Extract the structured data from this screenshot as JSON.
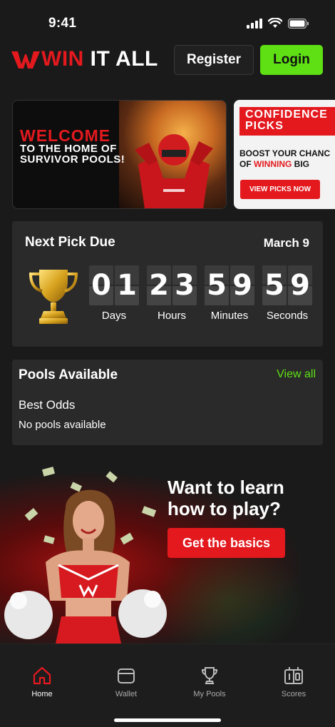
{
  "status": {
    "time": "9:41"
  },
  "header": {
    "logo_red": "WIN",
    "logo_white": "IT ALL",
    "register_label": "Register",
    "login_label": "Login"
  },
  "banners": {
    "welcome_title": "WELCOME",
    "welcome_sub": "TO THE HOME OF SURVIVOR POOLS!",
    "picks_title": "CONFIDENCE PICKS",
    "picks_line1": "BOOST YOUR CHANC",
    "picks_line2_prefix": "OF ",
    "picks_line2_red": "WINNING",
    "picks_line2_suffix": " BIG",
    "picks_button": "VIEW PICKS NOW"
  },
  "countdown": {
    "title": "Next Pick Due",
    "date": "March 9",
    "units": [
      {
        "value": "01",
        "label": "Days"
      },
      {
        "value": "23",
        "label": "Hours"
      },
      {
        "value": "59",
        "label": "Minutes"
      },
      {
        "value": "59",
        "label": "Seconds"
      }
    ]
  },
  "pools": {
    "title": "Pools Available",
    "view_all": "View all",
    "subtitle": "Best Odds",
    "empty": "No pools available"
  },
  "learn": {
    "title": "Want to learn how to play?",
    "button": "Get the basics"
  },
  "nav": [
    {
      "label": "Home",
      "icon": "home-icon",
      "active": true
    },
    {
      "label": "Wallet",
      "icon": "wallet-icon",
      "active": false
    },
    {
      "label": "My Pools",
      "icon": "trophy-icon",
      "active": false
    },
    {
      "label": "Scores",
      "icon": "scoreboard-icon",
      "active": false
    }
  ],
  "colors": {
    "brand_red": "#e3191e",
    "accent_green": "#5ee014",
    "background": "#1a1a1a",
    "card": "#2a2a2a"
  }
}
